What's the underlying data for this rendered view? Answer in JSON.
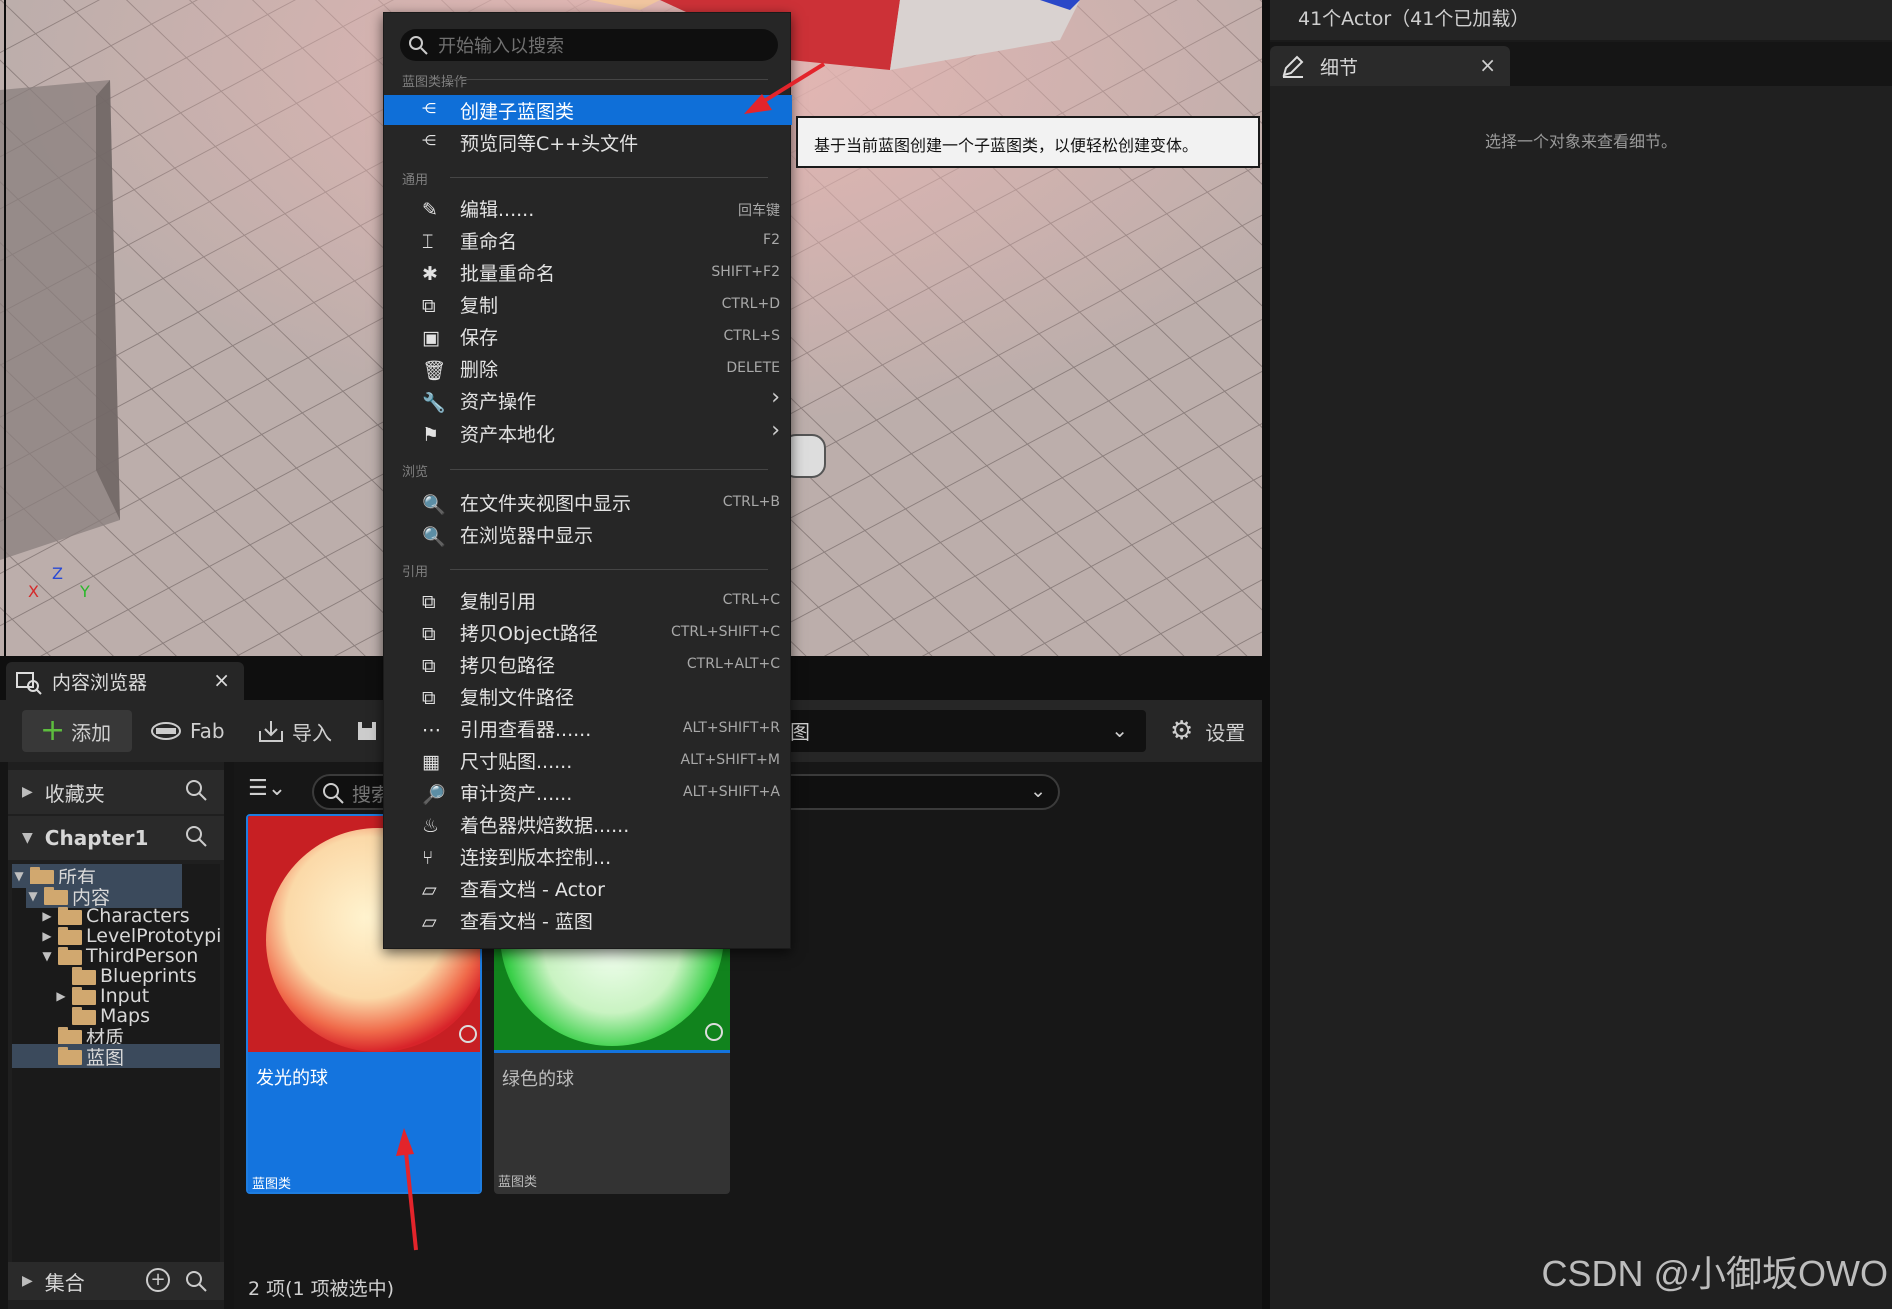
{
  "viewport": {
    "axis": {
      "x": "X",
      "y": "Y",
      "z": "Z"
    }
  },
  "outliner": {
    "status": "41个Actor（41个已加载）"
  },
  "details": {
    "tab_label": "细节",
    "close": "×",
    "empty_message": "选择一个对象来查看细节。"
  },
  "content_browser": {
    "tab_label": "内容浏览器",
    "close": "×",
    "toolbar": {
      "add": "添加",
      "fab": "Fab",
      "import": "导入",
      "path": "图",
      "settings": "设置"
    },
    "favorites": "收藏夹",
    "root_name": "Chapter1",
    "collections": "集合",
    "search_placeholder": "搜索",
    "tree": [
      {
        "label": "所有"
      },
      {
        "label": "内容"
      },
      {
        "label": "Characters"
      },
      {
        "label": "LevelPrototypi"
      },
      {
        "label": "ThirdPerson"
      },
      {
        "label": "Blueprints"
      },
      {
        "label": "Input"
      },
      {
        "label": "Maps"
      },
      {
        "label": "材质"
      },
      {
        "label": "蓝图"
      }
    ],
    "assets": [
      {
        "name": "发光的球",
        "kind": "蓝图类",
        "color": "#e0282c"
      },
      {
        "name": "绿色的球",
        "kind": "蓝图类",
        "color": "#1fb82e"
      }
    ],
    "status": "2 项(1 项被选中)"
  },
  "context_menu": {
    "search_placeholder": "开始输入以搜索",
    "sections": {
      "blueprint": "蓝图类操作",
      "common": "通用",
      "browse": "浏览",
      "references": "引用"
    },
    "items": [
      {
        "label": "创建子蓝图类",
        "shortcut": ""
      },
      {
        "label": "预览同等C++头文件",
        "shortcut": ""
      },
      {
        "label": "编辑......",
        "shortcut": "回车键"
      },
      {
        "label": "重命名",
        "shortcut": "F2"
      },
      {
        "label": "批量重命名",
        "shortcut": "SHIFT+F2"
      },
      {
        "label": "复制",
        "shortcut": "CTRL+D"
      },
      {
        "label": "保存",
        "shortcut": "CTRL+S"
      },
      {
        "label": "删除",
        "shortcut": "DELETE"
      },
      {
        "label": "资产操作",
        "shortcut": ""
      },
      {
        "label": "资产本地化",
        "shortcut": ""
      },
      {
        "label": "在文件夹视图中显示",
        "shortcut": "CTRL+B"
      },
      {
        "label": "在浏览器中显示",
        "shortcut": ""
      },
      {
        "label": "复制引用",
        "shortcut": "CTRL+C"
      },
      {
        "label": "拷贝Object路径",
        "shortcut": "CTRL+SHIFT+C"
      },
      {
        "label": "拷贝包路径",
        "shortcut": "CTRL+ALT+C"
      },
      {
        "label": "复制文件路径",
        "shortcut": ""
      },
      {
        "label": "引用查看器......",
        "shortcut": "ALT+SHIFT+R"
      },
      {
        "label": "尺寸贴图......",
        "shortcut": "ALT+SHIFT+M"
      },
      {
        "label": "审计资产......",
        "shortcut": "ALT+SHIFT+A"
      },
      {
        "label": "着色器烘焙数据......",
        "shortcut": ""
      },
      {
        "label": "连接到版本控制...",
        "shortcut": ""
      },
      {
        "label": "查看文档 - Actor",
        "shortcut": ""
      },
      {
        "label": "查看文档 - 蓝图",
        "shortcut": ""
      }
    ]
  },
  "tooltip": "基于当前蓝图创建一个子蓝图类，以便轻松创建变体。",
  "watermark": "CSDN @小御坂OWO",
  "colors": {
    "accent": "#0f6fd8",
    "selection": "#1474de",
    "annotation_arrow": "#e3242b"
  }
}
